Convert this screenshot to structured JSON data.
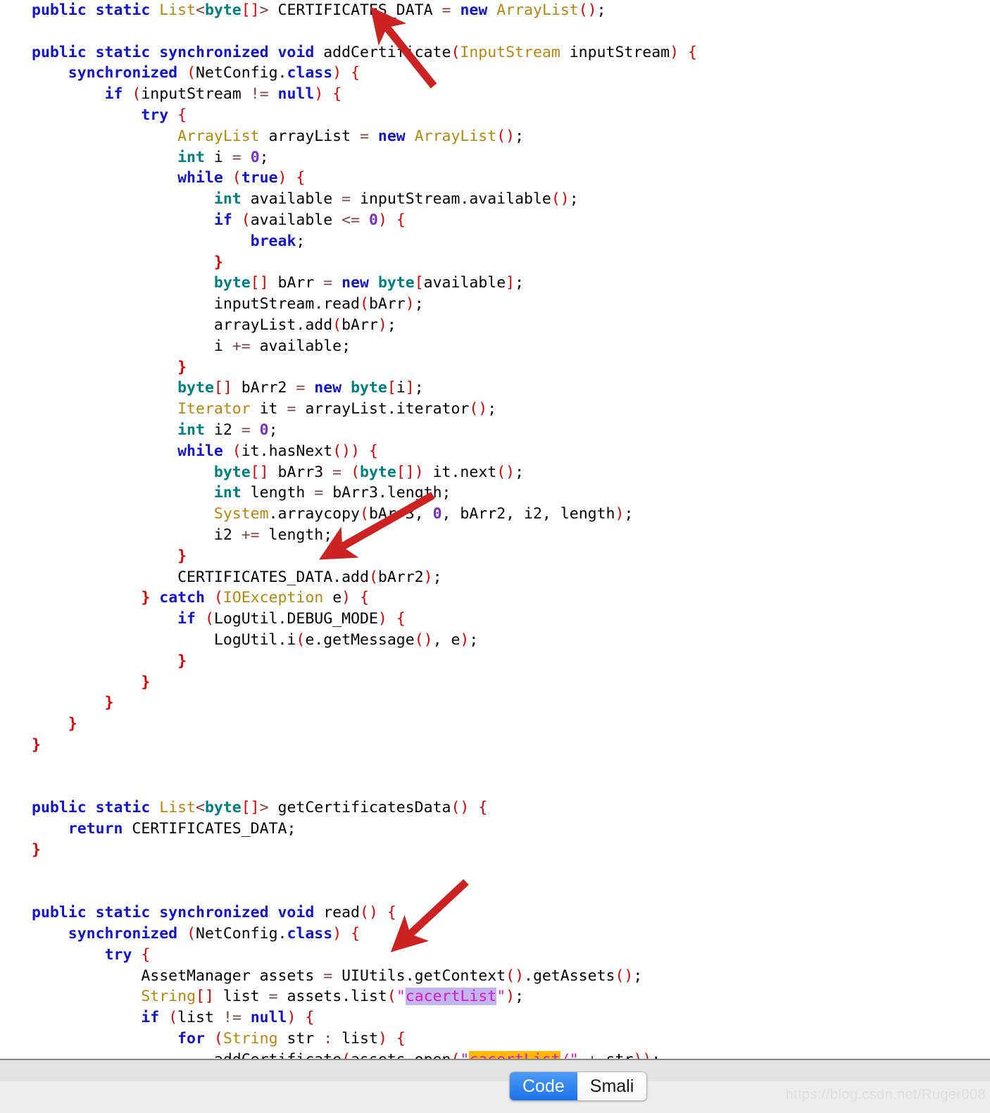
{
  "editor": {
    "language": "java",
    "background": "#ffffff",
    "lines": [
      "public static List<byte[]> CERTIFICATES_DATA = new ArrayList();",
      "",
      "public static synchronized void addCertificate(InputStream inputStream) {",
      "    synchronized (NetConfig.class) {",
      "        if (inputStream != null) {",
      "            try {",
      "                ArrayList arrayList = new ArrayList();",
      "                int i = 0;",
      "                while (true) {",
      "                    int available = inputStream.available();",
      "                    if (available <= 0) {",
      "                        break;",
      "                    }",
      "                    byte[] bArr = new byte[available];",
      "                    inputStream.read(bArr);",
      "                    arrayList.add(bArr);",
      "                    i += available;",
      "                }",
      "                byte[] bArr2 = new byte[i];",
      "                Iterator it = arrayList.iterator();",
      "                int i2 = 0;",
      "                while (it.hasNext()) {",
      "                    byte[] bArr3 = (byte[]) it.next();",
      "                    int length = bArr3.length;",
      "                    System.arraycopy(bArr3, 0, bArr2, i2, length);",
      "                    i2 += length;",
      "                }",
      "                CERTIFICATES_DATA.add(bArr2);",
      "            } catch (IOException e) {",
      "                if (LogUtil.DEBUG_MODE) {",
      "                    LogUtil.i(e.getMessage(), e);",
      "                }",
      "            }",
      "        }",
      "    }",
      "}",
      "",
      "public static List<byte[]> getCertificatesData() {",
      "    return CERTIFICATES_DATA;",
      "}",
      "",
      "public static synchronized void read() {",
      "    synchronized (NetConfig.class) {",
      "        try {",
      "            AssetManager assets = UIUtils.getContext().getAssets();",
      "            String[] list = assets.list(\"cacertList\");",
      "            if (list != null) {",
      "                for (String str : list) {",
      "                    addCertificate(assets.open(\"cacertList/\" + str));",
      "                }",
      "            }"
    ],
    "highlights": [
      {
        "text": "cacertList",
        "color": "#c3b6f0",
        "line": "String[] list = assets.list(\"cacertList\");"
      },
      {
        "text": "cacertList",
        "color": "#ffb900",
        "line": "addCertificate(assets.open(\"cacertList/\" + str));"
      }
    ],
    "token_colors": {
      "keyword": "#1414cc",
      "type": "#b8860b",
      "primitive": "#008080",
      "punctuation": "#dd0000",
      "number": "#7b2fbe",
      "operator": "#7a4444",
      "string": "#d619d6",
      "identifier": "#000000",
      "angle_bracket": "#8b3a3a"
    }
  },
  "annotations": {
    "color": "#cc2222",
    "arrows": [
      {
        "name": "arrow-to-certificates-data",
        "points_to": "CERTIFICATES_DATA",
        "direction": "up-left"
      },
      {
        "name": "arrow-to-arraycopy",
        "points_to": "System.arraycopy(bArr3, 0, bArr2, i2, length);",
        "direction": "down-left"
      },
      {
        "name": "arrow-to-uiutils",
        "points_to": "UIUtils.getContext()",
        "direction": "down-left"
      }
    ]
  },
  "bottom_bar": {
    "tabs": [
      {
        "label": "Code",
        "active": true
      },
      {
        "label": "Smali",
        "active": false
      }
    ],
    "active_color": "#1c72e6",
    "watermark": "https://blog.csdn.net/Ruger008"
  }
}
